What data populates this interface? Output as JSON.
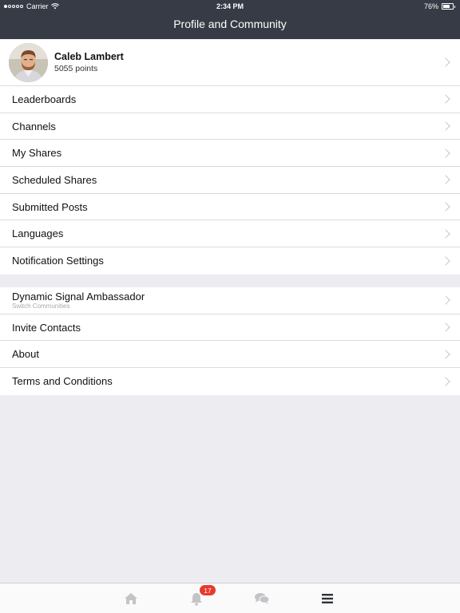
{
  "status_bar": {
    "carrier": "Carrier",
    "time": "2:34 PM",
    "battery": "76%",
    "battery_level": 0.76,
    "signal_bars_filled": 1
  },
  "header": {
    "title": "Profile and Community",
    "background": "#363b45"
  },
  "profile": {
    "name": "Caleb Lambert",
    "points": "5055 points"
  },
  "menu_main": [
    {
      "label": "Leaderboards"
    },
    {
      "label": "Channels"
    },
    {
      "label": "My Shares"
    },
    {
      "label": "Scheduled Shares"
    },
    {
      "label": "Submitted Posts"
    },
    {
      "label": "Languages"
    },
    {
      "label": "Notification Settings"
    }
  ],
  "menu_secondary": {
    "community": {
      "label": "Dynamic Signal Ambassador",
      "sublabel": "Switch Communities"
    },
    "items": [
      {
        "label": "Invite Contacts"
      },
      {
        "label": "About"
      },
      {
        "label": "Terms and Conditions"
      }
    ]
  },
  "tab_bar": {
    "tabs": [
      {
        "icon": "home-icon",
        "active": false
      },
      {
        "icon": "bell-icon",
        "active": false,
        "badge": "17"
      },
      {
        "icon": "chat-bubbles-icon",
        "active": false
      },
      {
        "icon": "menu-icon",
        "active": true
      }
    ],
    "badge_color": "#e8392f",
    "inactive_color": "#c4c4c8",
    "active_color": "#2e323a"
  }
}
